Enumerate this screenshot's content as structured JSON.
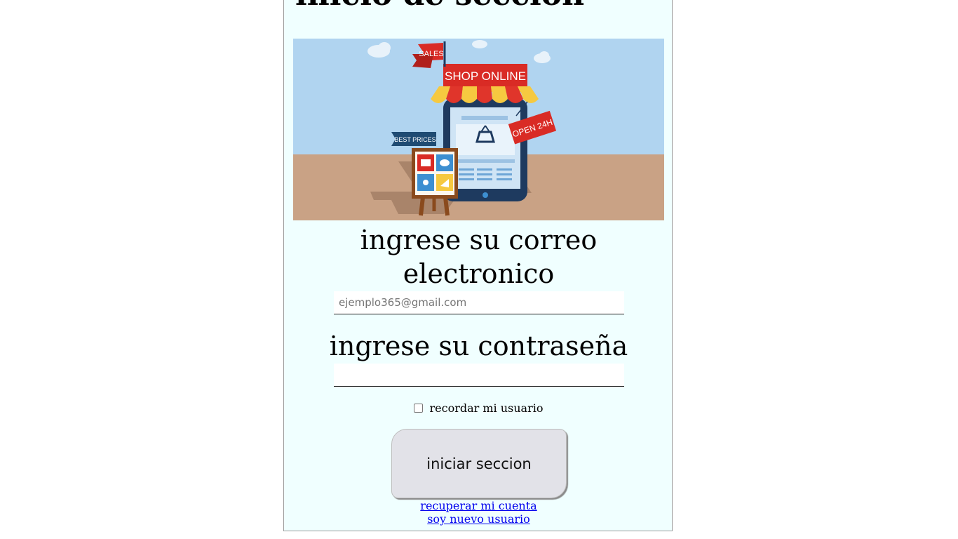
{
  "page": {
    "title": "inicio de seccion"
  },
  "hero": {
    "image_name": "shop-online-illustration",
    "sign_sales": "SALES",
    "sign_shop": "SHOP ONLINE",
    "sign_best_prices": "BEST PRICES",
    "sign_open": "OPEN 24H",
    "colors": {
      "sky": "#b0d4f0",
      "ground": "#c9a285",
      "phone": "#1e3a5f",
      "screen": "#cfe4f5",
      "awning_red": "#e0352b",
      "awning_yellow": "#f6c940",
      "banner_red": "#d92b25",
      "banner_dark": "#1f4b73"
    }
  },
  "form": {
    "email_label": "ingrese su correo electronico",
    "email_placeholder": "ejemplo365@gmail.com",
    "email_value": "",
    "password_label": "ingrese su contraseña",
    "password_value": "",
    "remember_label": "recordar mi usuario",
    "remember_checked": false,
    "submit_label": "iniciar seccion"
  },
  "links": {
    "recover": "recuperar mi cuenta",
    "new_user": "soy nuevo usuario"
  },
  "colors": {
    "card_background": "#f0ffff",
    "link": "#0000ee",
    "button_background": "#e2e2e8"
  }
}
